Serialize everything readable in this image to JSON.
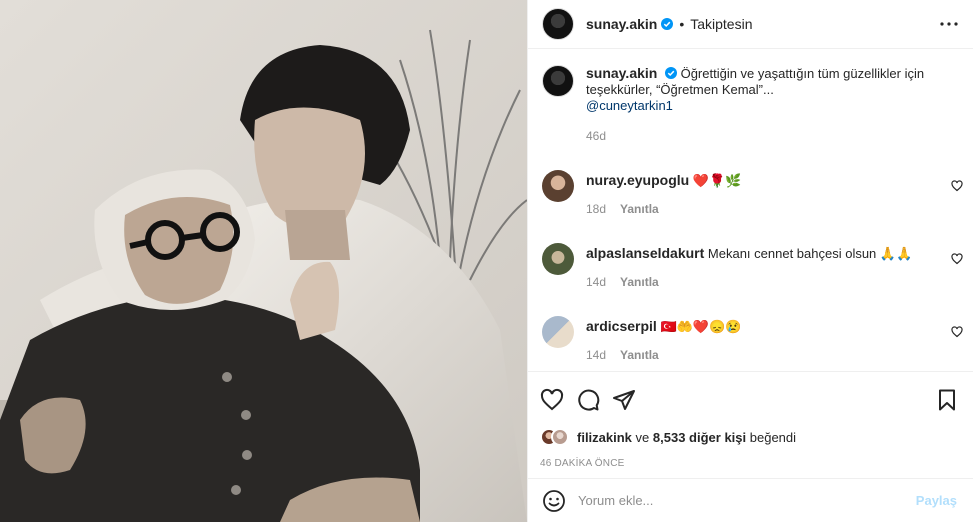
{
  "post": {
    "photo_alt": "Black and white photograph of an elderly woman with round glasses and a young man embracing her"
  },
  "header": {
    "username": "sunay.akin",
    "separator": "•",
    "follow_status": "Takiptesin"
  },
  "caption": {
    "username": "sunay.akin",
    "text": "Öğrettiğin ve yaşattığın tüm güzellikler için teşekkürler, “Öğretmen Kemal”...",
    "mention": "@cuneytarkin1",
    "time": "46d"
  },
  "comments": [
    {
      "username": "nuray.eyupoglu",
      "text": "❤️🌹🌿",
      "time": "18d",
      "reply": "Yanıtla",
      "avatar_color": "#8a6a4a"
    },
    {
      "username": "alpaslanseldakurt",
      "text": "Mekanı cennet bahçesi olsun 🙏🙏",
      "time": "14d",
      "reply": "Yanıtla",
      "avatar_color": "#6f7a52"
    },
    {
      "username": "ardicserpil",
      "text": "🇹🇷🤲❤️😞😢",
      "time": "14d",
      "reply": "Yanıtla",
      "avatar_color": "#7d8fa6"
    }
  ],
  "likes": {
    "first_user": "filizakink",
    "connector": "ve",
    "count_text": "8,533 diğer kişi",
    "suffix": "beğendi",
    "avatar_colors": [
      "#8c5a3c",
      "#c9b2a6"
    ]
  },
  "timestamp": "46 DAKİKA ÖNCE",
  "comment_box": {
    "placeholder": "Yorum ekle...",
    "post_label": "Paylaş"
  },
  "colors": {
    "verified": "#0095f6",
    "link": "#00376b",
    "post_disabled": "#b2dffc",
    "muted": "#8e8e8e"
  }
}
